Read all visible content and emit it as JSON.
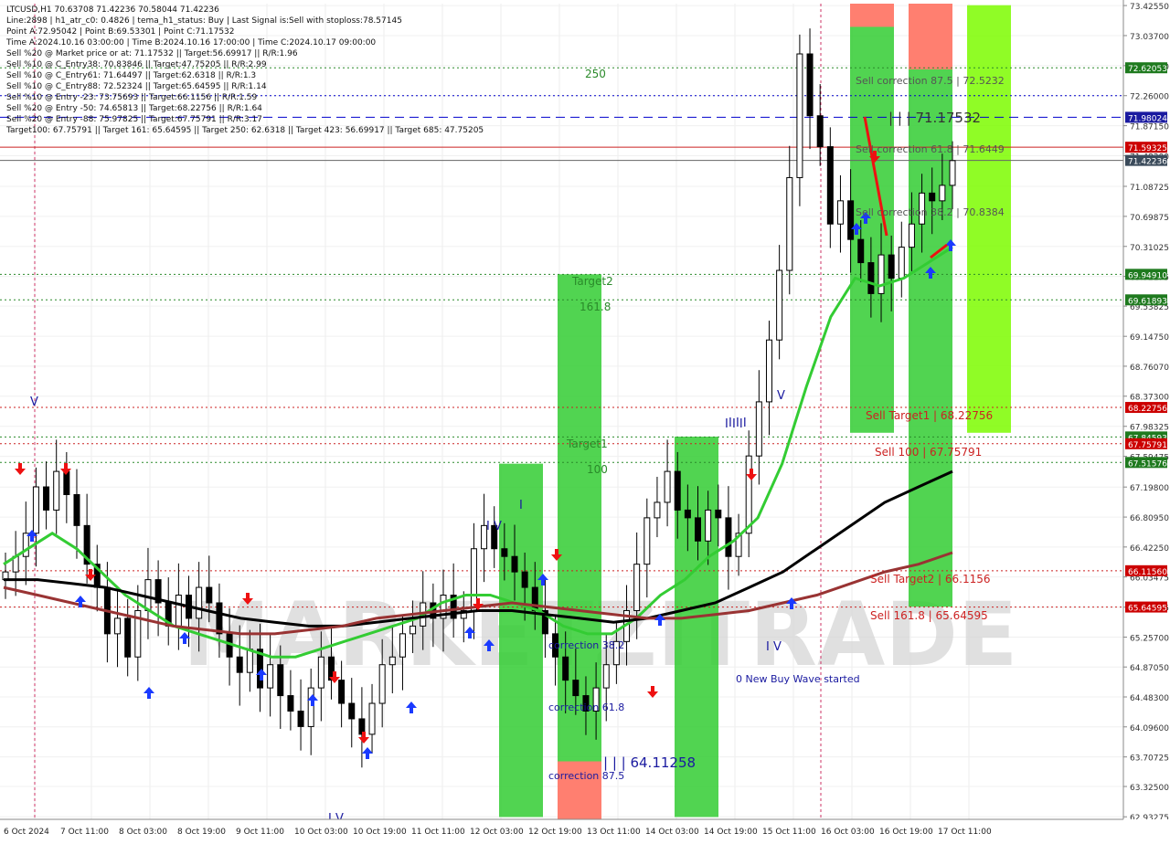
{
  "header_lines": [
    "LTCUSD,H1  70.63708 71.42236 70.58044 71.42236",
    "Line:2898  | h1_atr_c0: 0.4826  | tema_h1_status: Buy  | Last Signal is:Sell with stoploss:78.57145",
    "Point A:72.95042 | Point B:69.53301 | Point C:71.17532",
    "Time A:2024.10.16 03:00:00 | Time B:2024.10.16 17:00:00 | Time C:2024.10.17 09:00:00",
    "Sell %20 @ Market price or at: 71.17532 || Target:56.69917 || R/R:1.96",
    "Sell %10 @ C_Entry38: 70.83846 || Target:47.75205 || R/R:2.99",
    "Sell %10 @ C_Entry61: 71.64497 || Target:62.6318 || R/R:1.3",
    "Sell %10 @ C_Entry88: 72.52324 || Target:65.64595 || R/R:1.14",
    "Sell %10 @ Entry -23: 73.75693 || Target:66.1156 || R/R:1.59",
    "Sell %20 @ Entry -50: 74.65813 || Target:68.22756 || R/R:1.64",
    "Sell %20 @ Entry -88: 75.97825 || Target:67.75791 || R/R:3.17",
    "Target100: 67.75791 || Target 161: 65.64595 || Target 250: 62.6318 || Target 423: 56.69917 || Target 685: 47.75205"
  ],
  "colors": {
    "price_tag_default": "#1e7a1e",
    "price_tag_blue": "#1a1aa0",
    "price_tag_red": "#cc0000",
    "price_tag_dark": "#3a4a5a",
    "level_green": "#2a8a2a",
    "level_blue": "#0000cc",
    "level_red": "#cc2222",
    "zone_green": "#33cc33",
    "zone_lime": "#7cfc00",
    "zone_salmon": "#ff7f70",
    "ma_green": "#33cc33",
    "ma_black": "#000000",
    "ma_brown": "#993333",
    "candle": "#000000",
    "arrow_up": "#1a3aff",
    "arrow_down": "#ee1111"
  },
  "chart_data": {
    "type": "candlestick",
    "symbol": "LTCUSD",
    "timeframe": "H1",
    "title": "LTCUSD,H1",
    "ylim": [
      62.9,
      73.45
    ],
    "y_ticks": [
      "73.42550",
      "73.03700",
      "72.64850",
      "72.26000",
      "71.87150",
      "71.48300",
      "71.08725",
      "70.69875",
      "70.31025",
      "69.92175",
      "69.53825",
      "69.14750",
      "68.76070",
      "68.37300",
      "67.98325",
      "67.59475",
      "67.19800",
      "66.80950",
      "66.42250",
      "66.03475",
      "65.64425",
      "65.25700",
      "64.87050",
      "64.48300",
      "64.09600",
      "63.70725",
      "63.32500",
      "62.93275"
    ],
    "x_labels": [
      "6 Oct 2024",
      "7 Oct 11:00",
      "8 Oct 03:00",
      "8 Oct 19:00",
      "9 Oct 11:00",
      "10 Oct 03:00",
      "10 Oct 19:00",
      "11 Oct 11:00",
      "12 Oct 03:00",
      "12 Oct 19:00",
      "13 Oct 11:00",
      "14 Oct 03:00",
      "14 Oct 19:00",
      "15 Oct 11:00",
      "16 Oct 03:00",
      "16 Oct 19:00",
      "17 Oct 11:00"
    ],
    "last_price": 71.42236,
    "price_tags": [
      {
        "value": 73.4255,
        "text": "73.42550",
        "style": "none"
      },
      {
        "value": 72.62053,
        "text": "72.62053",
        "style": "green"
      },
      {
        "value": 71.98024,
        "text": "71.98024",
        "style": "blue"
      },
      {
        "value": 71.59325,
        "text": "71.59325",
        "style": "red"
      },
      {
        "value": 71.42236,
        "text": "71.42236",
        "style": "dark"
      },
      {
        "value": 69.9491,
        "text": "69.94910",
        "style": "green"
      },
      {
        "value": 69.61893,
        "text": "69.61893",
        "style": "green"
      },
      {
        "value": 68.22756,
        "text": "68.22756",
        "style": "red"
      },
      {
        "value": 67.84593,
        "text": "67.84593",
        "style": "green"
      },
      {
        "value": 67.75791,
        "text": "67.75791",
        "style": "red"
      },
      {
        "value": 67.51576,
        "text": "67.51576",
        "style": "green"
      },
      {
        "value": 66.1156,
        "text": "66.11560",
        "style": "red"
      },
      {
        "value": 65.64595,
        "text": "65.64595",
        "style": "red"
      }
    ],
    "levels": [
      {
        "value": 72.62053,
        "color": "green",
        "dash": "dotted",
        "label": "250"
      },
      {
        "value": 72.26,
        "color": "blue",
        "dash": "dotted",
        "label": "Sell correction 87.5 | 72.5232"
      },
      {
        "value": 71.98024,
        "color": "blue",
        "dash": "dashed",
        "label": "| | | 71.17532"
      },
      {
        "value": 71.59325,
        "color": "red",
        "dash": "solid",
        "label": "Sell correction 61.8 | 71.6449"
      },
      {
        "value": 71.42236,
        "color": "gray",
        "dash": "solid",
        "label": ""
      },
      {
        "value": 69.9491,
        "color": "green",
        "dash": "dotted",
        "label": "Target2"
      },
      {
        "value": 69.61893,
        "color": "green",
        "dash": "dotted",
        "label": "161.8"
      },
      {
        "value": 68.22756,
        "color": "red",
        "dash": "dotted",
        "label": "Sell Target1 | 68.22756"
      },
      {
        "value": 67.84593,
        "color": "green",
        "dash": "dotted",
        "label": "Target1"
      },
      {
        "value": 67.75791,
        "color": "red",
        "dash": "dotted",
        "label": "Sell 100 | 67.75791"
      },
      {
        "value": 67.51576,
        "color": "green",
        "dash": "dotted",
        "label": "100"
      },
      {
        "value": 66.1156,
        "color": "red",
        "dash": "dotted",
        "label": "Sell Target2 | 66.1156"
      },
      {
        "value": 65.64595,
        "color": "red",
        "dash": "dotted",
        "label": "Sell 161.8 | 65.64595"
      }
    ],
    "annotations": [
      "250",
      "Target2",
      "161.8",
      "Target1",
      "100",
      "correction 38.2",
      "correction 61.8",
      "correction 87.5",
      "| | | 64.11258",
      "0 New Buy Wave started",
      "Sell correction 87.5 | 72.5232",
      "| | | 71.17532",
      "Sell correction 61.8 | 71.6449",
      "Sell correction 38.2 | 70.8384",
      "Sell Target1 | 68.22756",
      "Sell 100 | 67.75791",
      "Sell Target2 | 66.1156",
      "Sell 161.8 | 65.64595"
    ],
    "wave_labels": [
      "V",
      "I V",
      "I",
      "I V",
      "I I I",
      "V",
      "I V",
      "I I I",
      "I I I"
    ],
    "series": [
      {
        "name": "price_close",
        "values": [
          66.1,
          66.3,
          66.6,
          67.2,
          66.9,
          67.4,
          67.1,
          66.7,
          66.2,
          65.9,
          65.3,
          65.5,
          65.0,
          65.6,
          66.0,
          65.7,
          65.4,
          65.8,
          65.5,
          65.9,
          65.7,
          65.3,
          65.0,
          64.8,
          65.1,
          64.6,
          64.9,
          64.5,
          64.3,
          64.1,
          64.6,
          65.0,
          64.7,
          64.4,
          64.2,
          64.0,
          64.4,
          64.9,
          65.0,
          65.3,
          65.4,
          65.7,
          65.5,
          65.8,
          65.5,
          65.6,
          66.4,
          66.7,
          66.4,
          66.3,
          66.1,
          65.9,
          65.6,
          65.3,
          65.0,
          64.7,
          64.5,
          64.3,
          64.6,
          64.9,
          65.2,
          65.6,
          66.2,
          66.8,
          67.0,
          67.4,
          66.9,
          66.8,
          66.5,
          66.9,
          66.8,
          66.3,
          66.6,
          67.6,
          68.3,
          69.1,
          70.0,
          71.2,
          72.8,
          72.0,
          71.6,
          70.6,
          70.9,
          70.4,
          70.1,
          69.7,
          70.2,
          69.9,
          70.3,
          70.6,
          71.0,
          70.9,
          71.1,
          71.42
        ]
      },
      {
        "name": "ma_green",
        "values": [
          66.2,
          66.4,
          66.6,
          66.4,
          66.1,
          65.8,
          65.6,
          65.4,
          65.3,
          65.2,
          65.1,
          65.0,
          65.0,
          65.1,
          65.2,
          65.3,
          65.4,
          65.5,
          65.7,
          65.8,
          65.8,
          65.7,
          65.6,
          65.4,
          65.3,
          65.3,
          65.5,
          65.8,
          66.0,
          66.3,
          66.5,
          66.8,
          67.5,
          68.5,
          69.4,
          69.9,
          69.8,
          69.9,
          70.1,
          70.3
        ]
      },
      {
        "name": "ma_black",
        "values": [
          66.0,
          66.0,
          65.95,
          65.9,
          65.8,
          65.7,
          65.6,
          65.5,
          65.45,
          65.4,
          65.4,
          65.45,
          65.5,
          65.55,
          65.6,
          65.6,
          65.55,
          65.5,
          65.45,
          65.5,
          65.6,
          65.7,
          65.9,
          66.1,
          66.4,
          66.7,
          67.0,
          67.2,
          67.4
        ]
      },
      {
        "name": "ma_brown",
        "values": [
          65.9,
          65.8,
          65.7,
          65.6,
          65.5,
          65.4,
          65.35,
          65.3,
          65.3,
          65.35,
          65.4,
          65.5,
          65.55,
          65.6,
          65.65,
          65.7,
          65.65,
          65.6,
          65.55,
          65.5,
          65.5,
          65.55,
          65.6,
          65.7,
          65.8,
          65.95,
          66.1,
          66.2,
          66.35
        ]
      }
    ],
    "zones": [
      {
        "from_x": "12 Oct 03:00",
        "low": 62.93,
        "high": 67.5,
        "color": "green"
      },
      {
        "from_x": "12 Oct 19:00",
        "low": 62.93,
        "high": 69.95,
        "color": "green"
      },
      {
        "from_x": "14 Oct 03:00",
        "low": 62.93,
        "high": 67.85,
        "color": "green"
      },
      {
        "from_x": "16 Oct 03:00",
        "low": 67.9,
        "high": 73.43,
        "color": "green"
      },
      {
        "from_x": "16 Oct 19:00",
        "low": 65.65,
        "high": 73.43,
        "color": "green"
      },
      {
        "from_x": "17 Oct 11:00",
        "low": 67.9,
        "high": 73.43,
        "color": "lime"
      }
    ],
    "grid": true,
    "watermark": "MARKETZITRADE"
  }
}
